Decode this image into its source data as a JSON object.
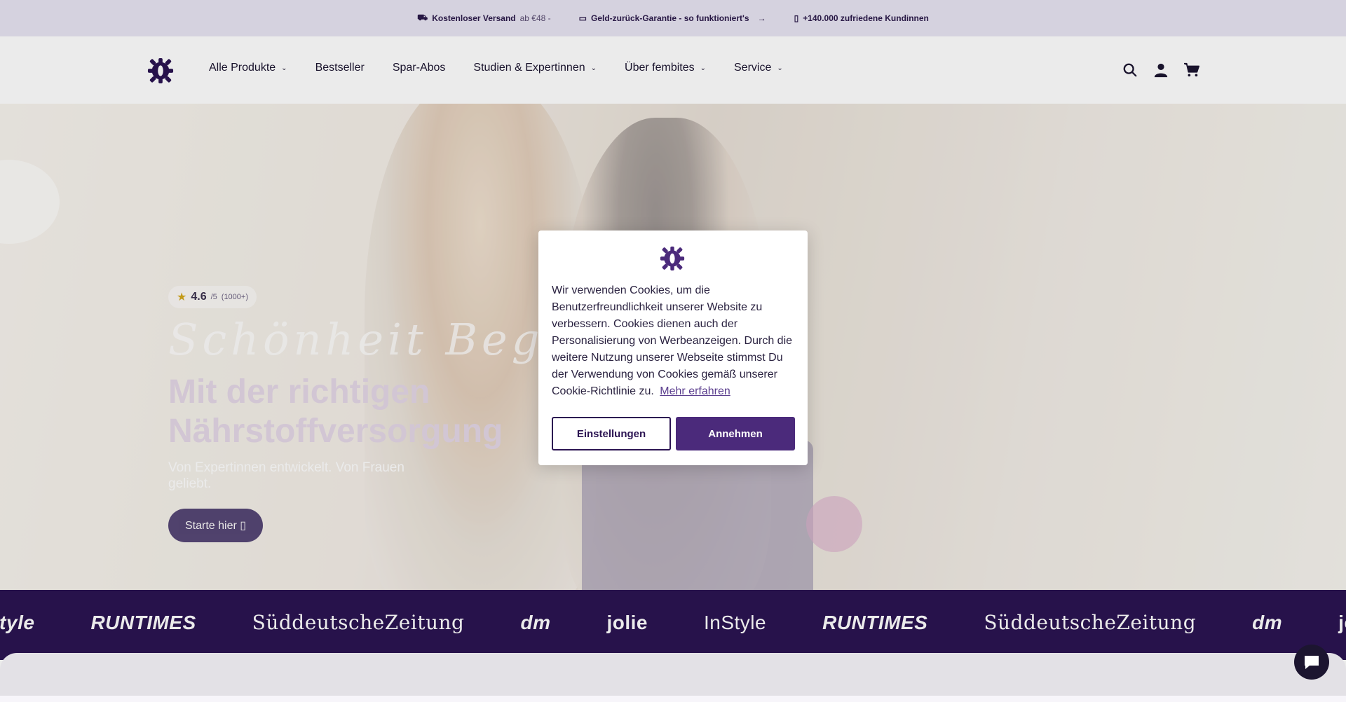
{
  "topbar": {
    "shipping": "Kostenloser Versand",
    "shipping_suffix": "ab €48 -",
    "guarantee": "Geld-zurück-Garantie - so funktioniert's",
    "customers": "+140.000 zufriedene Kundinnen",
    "icons": [
      "truck-icon",
      "card-icon",
      "heart-icon",
      "arrow-right-icon"
    ]
  },
  "nav": {
    "all_products": "Alle Produkte",
    "bestseller": "Bestseller",
    "spar_abos": "Spar-Abos",
    "studien": "Studien & Expertinnen",
    "ueber": "Über fembites",
    "service": "Service"
  },
  "hero": {
    "rating_value": "4.6",
    "rating_scale": "/5",
    "rating_count": "(1000+)",
    "script_text": "Schönheit Beginnt",
    "title": "Mit der richtigen Nährstoffversorgung",
    "subtitle": "Von Expertinnen entwickelt. Von Frauen geliebt.",
    "cta": "Starte hier ▯"
  },
  "press": {
    "logos": [
      "Style",
      "RUNTIMES",
      "SüddeutscheZeitung",
      "dm",
      "jolie",
      "InStyle",
      "RUNTIMES",
      "SüddeutscheZeitung",
      "dm",
      "jolie"
    ]
  },
  "cookie": {
    "text": "Wir verwenden Cookies, um die Benutzerfreundlichkeit unserer Website zu verbessern. Cookies dienen auch der Personalisierung von Werbeanzeigen. Durch die weitere Nutzung unserer Webseite stimmst Du der Verwendung von Cookies gemäß unserer Cookie-Richtlinie zu.",
    "link": "Mehr erfahren",
    "settings": "Einstellungen",
    "accept": "Annehmen"
  },
  "colors": {
    "brand_purple": "#4b2a7b",
    "press_band": "#2b1452",
    "topbar_bg": "#e8e4f2"
  }
}
